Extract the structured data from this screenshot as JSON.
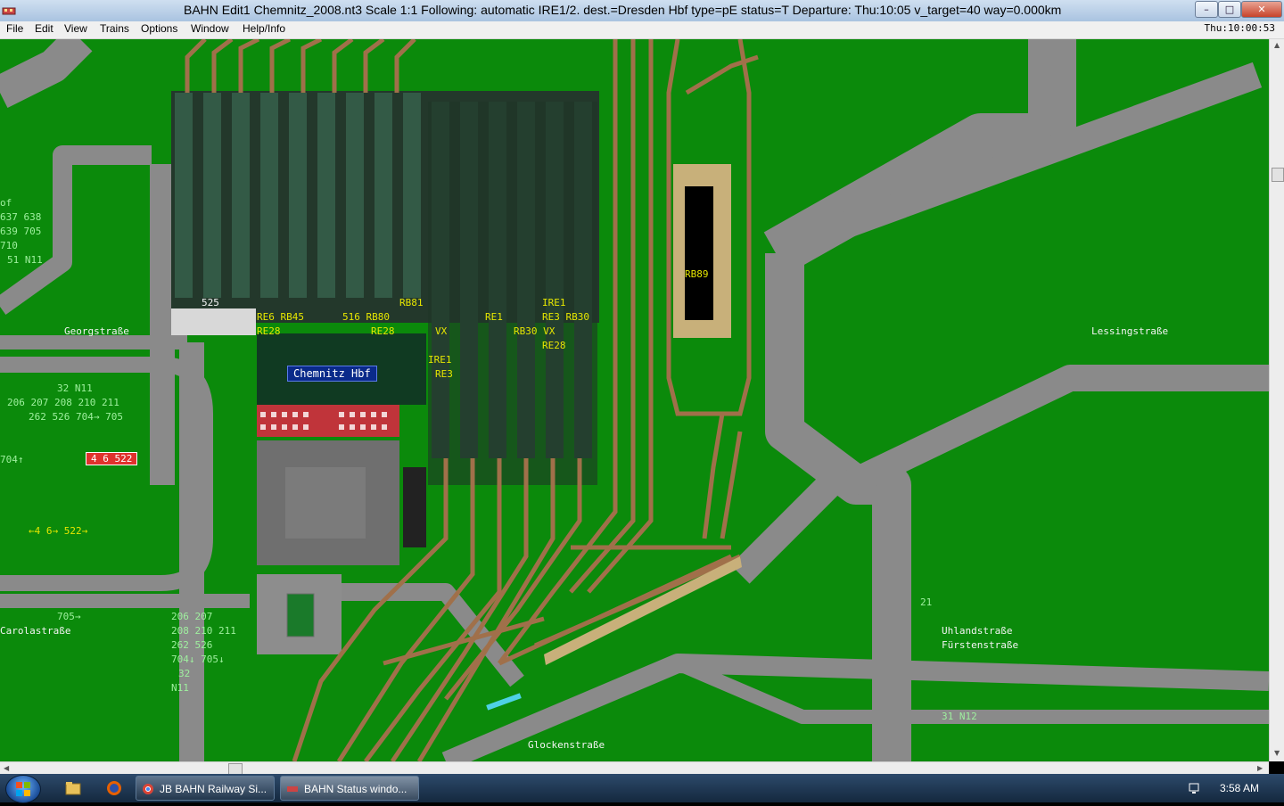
{
  "window": {
    "title": "BAHN Edit1 Chemnitz_2008.nt3 Scale 1:1 Following: automatic IRE1/2.  dest.=Dresden Hbf type=pE status=T  Departure: Thu:10:05 v_target=40 way=0.000km",
    "buttons": {
      "minimize": "–",
      "maximize": "□",
      "close": "✕"
    }
  },
  "menu": {
    "items": [
      "File",
      "Edit",
      "View",
      "Trains",
      "Options",
      "Window",
      "Help/Info"
    ],
    "clock": "Thu:10:00:53"
  },
  "map": {
    "station_name": "Chemnitz Hbf",
    "streets": [
      "Georgstraße",
      "Lessingstraße",
      "Carolastraße",
      "Uhlandstraße",
      "Fürstenstraße",
      "Glockenstraße"
    ],
    "platform_labels": [
      {
        "text": "525",
        "color": "white"
      },
      {
        "text": "RE6 RB45",
        "color": "yellow"
      },
      {
        "text": "RE28",
        "color": "yellow"
      },
      {
        "text": "516 RB80",
        "color": "yellow"
      },
      {
        "text": "RE28",
        "color": "yellow"
      },
      {
        "text": "RB81",
        "color": "yellow"
      },
      {
        "text": "VX",
        "color": "yellow"
      },
      {
        "text": "IRE1",
        "color": "yellow"
      },
      {
        "text": "RE3",
        "color": "yellow"
      },
      {
        "text": "RE1",
        "color": "yellow"
      },
      {
        "text": "RB30 VX",
        "color": "yellow"
      },
      {
        "text": "IRE1",
        "color": "yellow"
      },
      {
        "text": "RE3 RB30",
        "color": "yellow"
      },
      {
        "text": "RE28",
        "color": "yellow"
      },
      {
        "text": "RB89",
        "color": "yellow"
      }
    ],
    "route_labels_left": [
      "of",
      "637 638",
      "639 705",
      "710",
      "51 N11"
    ],
    "route_labels_stop1": [
      "32 N11",
      "206 207 208 210 211",
      "262 526 704→ 705"
    ],
    "red_tag": "4 6 522",
    "other_labels": {
      "left_704": "704↑",
      "arrows_522": "←4 6→ 522→",
      "c705": "705→",
      "stop2": [
        "206 207",
        "208 210 211",
        "262 526",
        "704↓ 705↓",
        "32",
        "N11"
      ],
      "label_21": "21",
      "label_31": "31 N12"
    }
  },
  "taskbar": {
    "buttons": [
      {
        "label": "JB BAHN Railway Si...",
        "active": false
      },
      {
        "label": "BAHN Status windo...",
        "active": true
      }
    ],
    "time": "3:58 AM"
  },
  "colors": {
    "grass": "#0b8a0b",
    "road": "#8a8a8a",
    "track": "#a0704a",
    "platform_roof": "#1e3e2c",
    "station_building": "#c0343a"
  }
}
